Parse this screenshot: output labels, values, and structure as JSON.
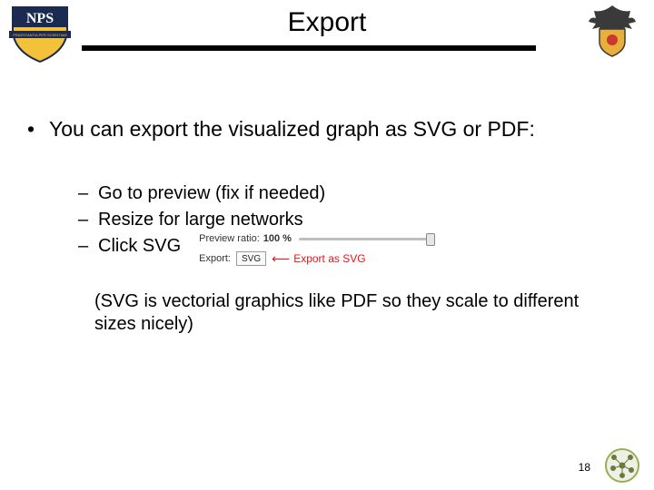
{
  "title": "Export",
  "main_bullet": "You can export the visualized graph as SVG or PDF:",
  "sub_bullets": {
    "item1": "Go to preview (fix if needed)",
    "item2": "Resize for large networks",
    "item3": "Click SVG"
  },
  "preview_widget": {
    "ratio_label": "Preview ratio:",
    "ratio_value": "100 %",
    "export_label": "Export:",
    "svg_button": "SVG",
    "arrow_text": "Export as SVG"
  },
  "note": "(SVG is vectorial graphics like PDF so they scale to different sizes nicely)",
  "page_number": "18"
}
